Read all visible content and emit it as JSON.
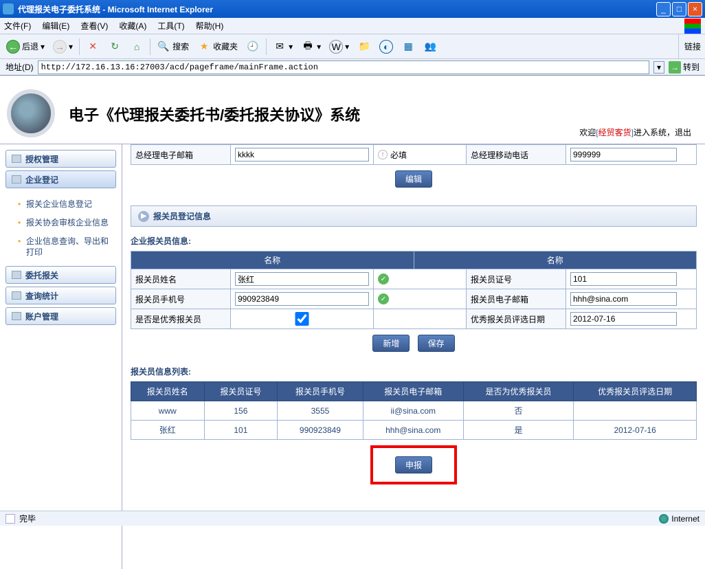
{
  "window": {
    "title": "代理报关电子委托系统 - Microsoft Internet Explorer"
  },
  "menu": {
    "file": "文件(F)",
    "edit": "编辑(E)",
    "view": "查看(V)",
    "favorites": "收藏(A)",
    "tools": "工具(T)",
    "help": "帮助(H)"
  },
  "toolbar": {
    "back": "后退",
    "search": "搜索",
    "favorites": "收藏夹",
    "links": "链接"
  },
  "address": {
    "label": "地址(D)",
    "url": "http://172.16.13.16:27003/acd/pageframe/mainFrame.action",
    "go": "转到"
  },
  "page": {
    "title": "电子《代理报关委托书/委托报关协议》系统",
    "welcome_pre": "欢迎",
    "welcome_user": "经贸客货",
    "welcome_mid": "进入系统，",
    "welcome_logout": "退出"
  },
  "sidebar": {
    "auth": "授权管理",
    "ent_reg": "企业登记",
    "sub1": "报关企业信息登记",
    "sub2": "报关协会审核企业信息",
    "sub3": "企业信息查询、导出和打印",
    "delegate": "委托报关",
    "query": "查询统计",
    "account": "账户管理"
  },
  "top_form": {
    "label1": "总经理电子邮箱",
    "value1": "kkkk",
    "req_text": "必填",
    "label2": "总经理移动电话",
    "value2": "999999",
    "edit_btn": "编辑"
  },
  "section": {
    "header": "报关员登记信息",
    "info_title": "企业报关员信息:",
    "col_name": "名称",
    "name_label": "报关员姓名",
    "name_value": "张红",
    "cert_label": "报关员证号",
    "cert_value": "101",
    "phone_label": "报关员手机号",
    "phone_value": "990923849",
    "email_label": "报关员电子邮箱",
    "email_value": "hhh@sina.com",
    "excellent_label": "是否是优秀报关员",
    "date_label": "优秀报关员评选日期",
    "date_value": "2012-07-16",
    "add_btn": "新增",
    "save_btn": "保存"
  },
  "list": {
    "title": "报关员信息列表:",
    "h1": "报关员姓名",
    "h2": "报关员证号",
    "h3": "报关员手机号",
    "h4": "报关员电子邮箱",
    "h5": "是否为优秀报关员",
    "h6": "优秀报关员评选日期",
    "rows": [
      {
        "c1": "www",
        "c2": "156",
        "c3": "3555",
        "c4": "ii@sina.com",
        "c5": "否",
        "c6": ""
      },
      {
        "c1": "张红",
        "c2": "101",
        "c3": "990923849",
        "c4": "hhh@sina.com",
        "c5": "是",
        "c6": "2012-07-16"
      }
    ],
    "submit_btn": "申报"
  },
  "status": {
    "done": "完毕",
    "zone": "Internet"
  }
}
